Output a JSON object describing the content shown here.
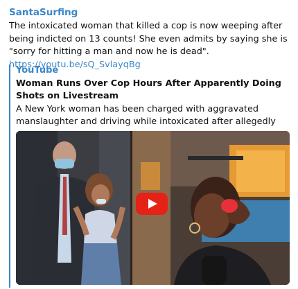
{
  "message": {
    "sender": "SantaSurfing",
    "text": "The intoxicated woman that killed a cop is now weeping after being indicted on 13 counts!  She even admits by saying she is \"sorry for hitting a man and now he is dead\".  ",
    "link": "https://youtu.be/sQ_SvlayqBg"
  },
  "preview": {
    "site_name": "YouTube",
    "title": "Woman Runs Over Cop Hours After Apparently Doing Shots on Livestream",
    "description": "A New York woman has been charged with aggravated manslaughter and driving while intoxicated after allegedly mowi..."
  },
  "colors": {
    "accent": "#3a86c8",
    "play_button": "#e62117"
  },
  "icons": {
    "play": "play-icon"
  }
}
